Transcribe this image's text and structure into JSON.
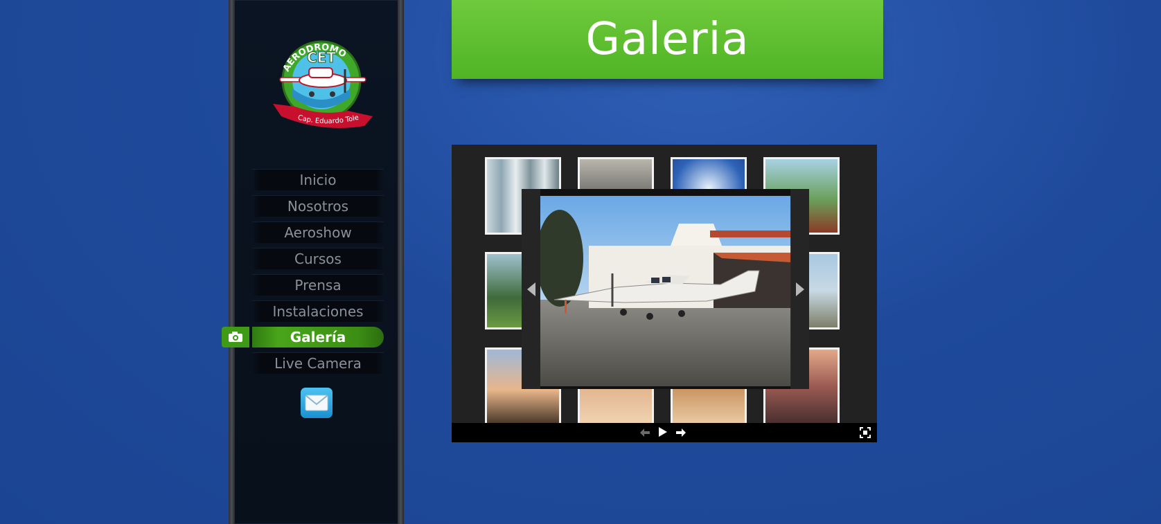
{
  "logo": {
    "arc_text": "AERODROMO",
    "center_text": "CET",
    "ribbon_text": "Cap. Eduardo Toledo"
  },
  "nav": {
    "items": [
      {
        "label": "Inicio",
        "active": false
      },
      {
        "label": "Nosotros",
        "active": false
      },
      {
        "label": "Aeroshow",
        "active": false
      },
      {
        "label": "Cursos",
        "active": false
      },
      {
        "label": "Prensa",
        "active": false
      },
      {
        "label": "Instalaciones",
        "active": false
      },
      {
        "label": "Galería",
        "active": true
      },
      {
        "label": "Live Camera",
        "active": false
      }
    ]
  },
  "header": {
    "title": "Galeria"
  },
  "icons": {
    "camera": "camera-icon",
    "mail": "mail-icon",
    "prev": "arrow-left-icon",
    "next": "arrow-right-icon",
    "play": "play-icon",
    "fullscreen": "fullscreen-icon"
  },
  "colors": {
    "background": "#1f4a9c",
    "accent_green": "#4fb424",
    "sidebar": "#0b1422"
  }
}
